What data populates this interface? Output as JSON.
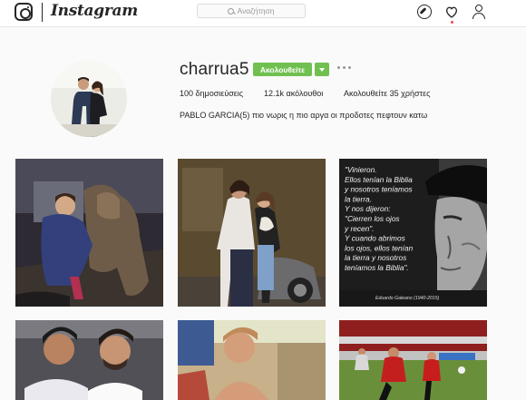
{
  "header": {
    "brand": "Instagram",
    "search_placeholder": "Αναζήτηση",
    "nav_icons": [
      "explore-icon",
      "heart-icon",
      "person-icon"
    ]
  },
  "profile": {
    "username": "charrua5",
    "follow_label": "Ακολουθείτε",
    "stats": {
      "posts": "100",
      "posts_label": "δημοσιεύσεις",
      "followers": "12.1k",
      "followers_label": "ακόλουθοι",
      "following_prefix": "Ακολουθείτε",
      "following": "35",
      "following_label": "χρήστες"
    },
    "bio": "PABLO GARCIA(5) πιο νωρις η πιο αργα οι προδοτες πεφτουν κατω"
  },
  "posts": [
    {
      "alt": "Boy hugging a large dog at night"
    },
    {
      "alt": "Couple posing together indoors"
    },
    {
      "quote": [
        "\"Vinieron.",
        "Ellos tenían la Biblia",
        "y nosotros teníamos",
        "la tierra.",
        "Y nos dijeron:",
        "\"Cierren los ojos",
        "y recen\".",
        "Y cuando abrimos",
        "los ojos, ellos tenían",
        "la tierra y nosotros",
        "teníamos la Biblia\"."
      ],
      "credit": "Eduardo Galeano (1940-2015)"
    },
    {
      "alt": "Two men selfie"
    },
    {
      "alt": "Young boy vintage photo"
    },
    {
      "alt": "Football players in red kits"
    }
  ],
  "colors": {
    "follow_green": "#70c050",
    "notif_red": "#ed4956"
  }
}
